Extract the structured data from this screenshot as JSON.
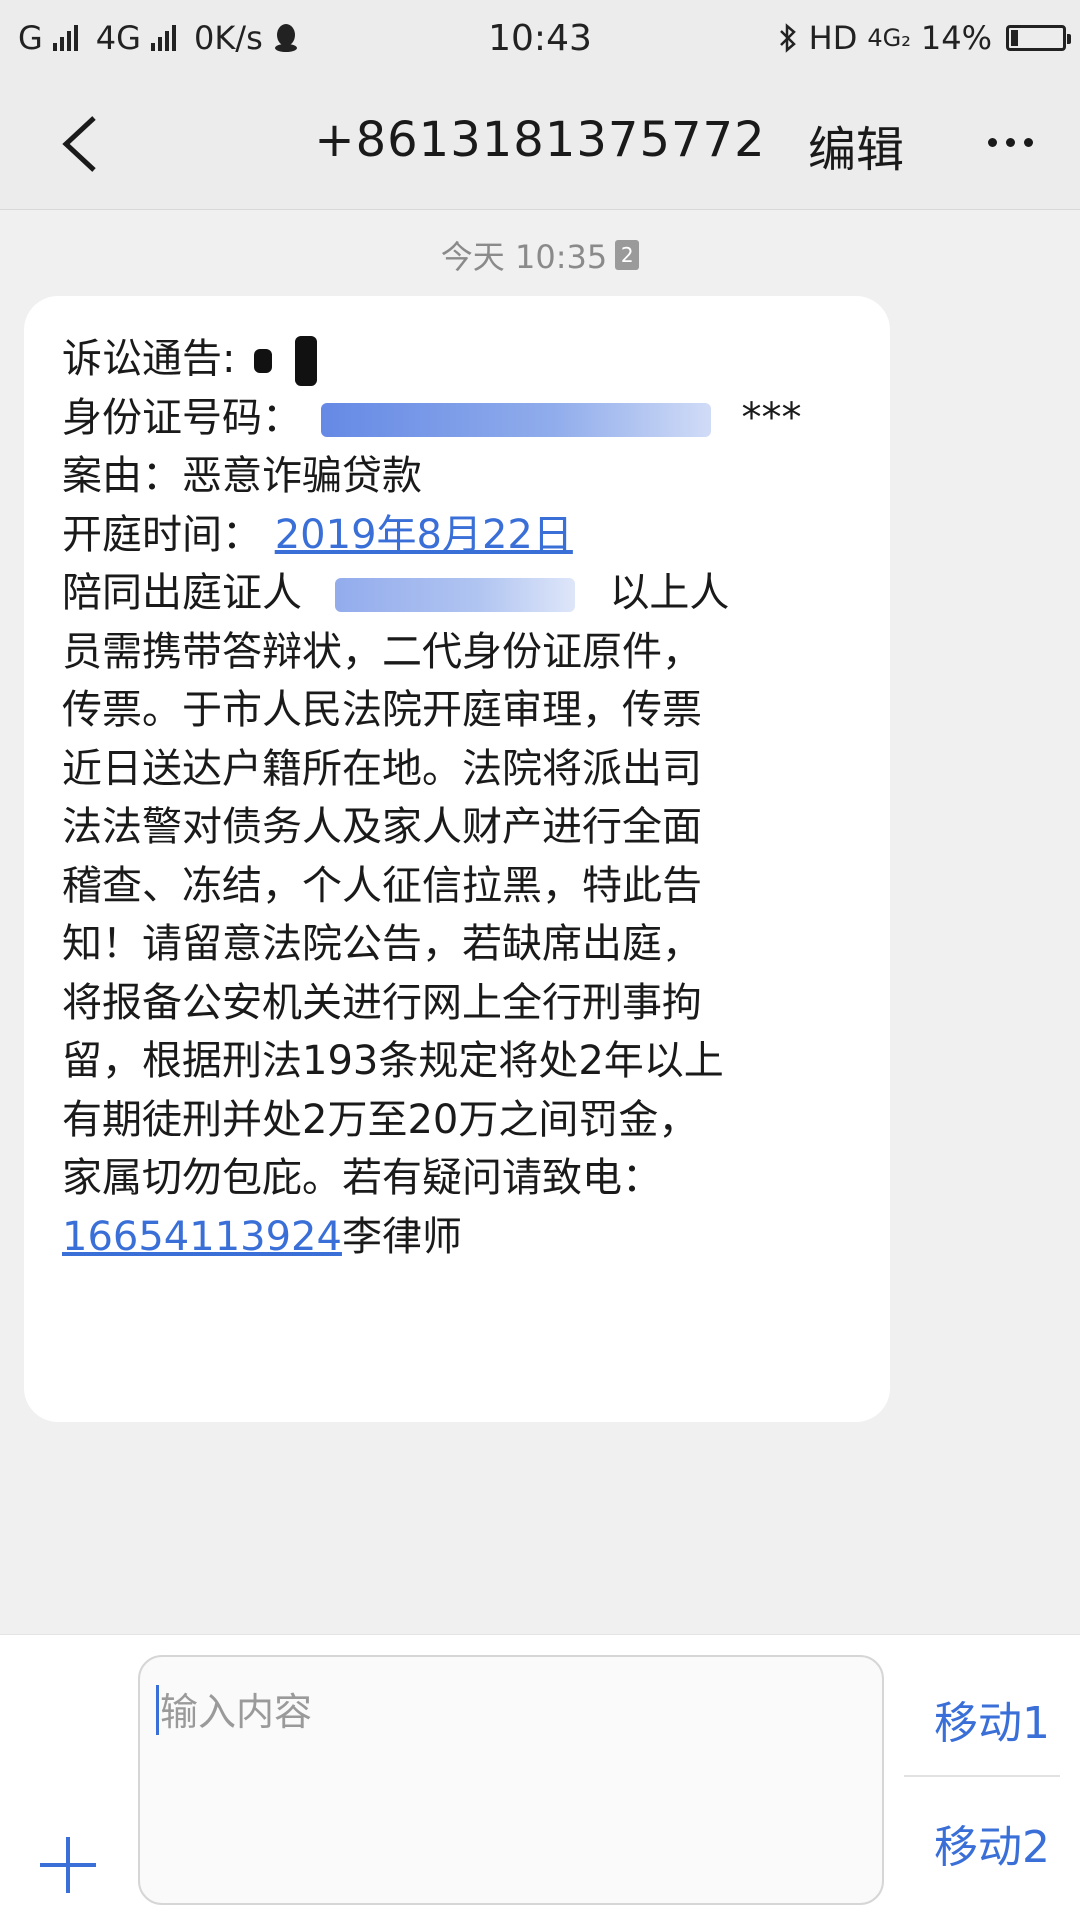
{
  "status_bar": {
    "network1": "G",
    "network2": "4G",
    "speed": "0K/s",
    "time": "10:43",
    "hd": "HD",
    "network3": "4G₂",
    "battery_text": "14%",
    "battery_level": 0.14
  },
  "header": {
    "title": "+8613181375772",
    "edit_label": "编辑"
  },
  "conversation": {
    "timestamp": "今天 10:35",
    "sim_badge": "2"
  },
  "message": {
    "line1": "诉讼通告:",
    "line2_label": "身份证号码：",
    "line2_tail": "***",
    "line3": "案由：恶意诈骗贷款",
    "line4_label": "开庭时间：",
    "line4_date": "2019年8月22日",
    "line5_label": "陪同出庭证人",
    "line5_tail": "以上人",
    "line6": "员需携带答辩状，二代身份证原件，",
    "line7": "传票。于市人民法院开庭审理，传票",
    "line8": "近日送达户籍所在地。法院将派出司",
    "line9": "法法警对债务人及家人财产进行全面",
    "line10": "稽查、冻结，个人征信拉黑，特此告",
    "line11": "知！请留意法院公告，若缺席出庭，",
    "line12": "将报备公安机关进行网上全行刑事拘",
    "line13": "留，根据刑法193条规定将处2年以上",
    "line14": "有期徒刑并处2万至20万之间罚金，",
    "line15": "家属切勿包庇。若有疑问请致电：",
    "phone": "16654113924",
    "phone_suffix": "李律师"
  },
  "composer": {
    "placeholder": "输入内容",
    "sim1_label": "移动1",
    "sim2_label": "移动2"
  }
}
